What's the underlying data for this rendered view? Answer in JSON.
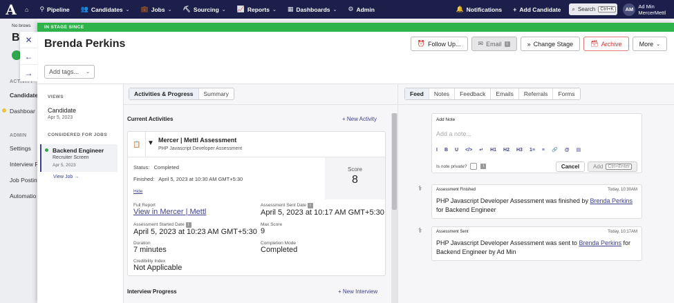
{
  "nav": {
    "items": [
      {
        "icon": "filter-icon",
        "glyph": "⚲",
        "label": "Pipeline",
        "caret": false
      },
      {
        "icon": "people-icon",
        "glyph": "👥",
        "label": "Candidates",
        "caret": true
      },
      {
        "icon": "briefcase-icon",
        "glyph": "💼",
        "label": "Jobs",
        "caret": true
      },
      {
        "icon": "sourcing-icon",
        "glyph": "⛏",
        "label": "Sourcing",
        "caret": true
      },
      {
        "icon": "chart-icon",
        "glyph": "📈",
        "label": "Reports",
        "caret": true
      },
      {
        "icon": "dashboard-icon",
        "glyph": "▦",
        "label": "Dashboards",
        "caret": true
      },
      {
        "icon": "gear-icon",
        "glyph": "⚙",
        "label": "Admin",
        "caret": false
      }
    ],
    "notifications": "Notifications",
    "add_candidate": "Add Candidate",
    "search": "Search",
    "search_kbd": "Ctrl+K",
    "avatar_initials": "AM",
    "user_name": "Ad Min",
    "user_org": "MercerMettl"
  },
  "background": {
    "title": "Ba",
    "browser_note": "No brows",
    "sections": [
      "ACTIVITY",
      "ADMIN"
    ],
    "items": [
      "Candidate",
      "Dashboar",
      "Settings",
      "Interview F",
      "Job Posting",
      "Automatio"
    ]
  },
  "drawer": {
    "stage_banner": "IN STAGE SINCE",
    "candidate_name": "Brenda Perkins",
    "tags_placeholder": "Add tags...",
    "actions": {
      "follow_up": "Follow Up...",
      "email": "Email",
      "change_stage": "Change Stage",
      "archive": "Archive",
      "more": "More"
    }
  },
  "left_panel": {
    "views_label": "VIEWS",
    "view_title": "Candidate",
    "view_date": "Apr 5, 2023",
    "considered_label": "CONSIDERED FOR JOBS",
    "job_title": "Backend Engineer",
    "job_stage": "Recruiter Screen",
    "job_date": "Apr 5, 2023",
    "view_job": "View Job →"
  },
  "middle": {
    "tabs": [
      "Activities & Progress",
      "Summary"
    ],
    "current_activities": "Current Activities",
    "new_activity": "+ New Activity",
    "assessment": {
      "title": "Mercer | Mettl Assessment",
      "subtitle": "PHP Javascript Developer Assessment",
      "status_label": "Status:",
      "status_value": "Completed",
      "finished_label": "Finished:",
      "finished_value": "April 5, 2023 at 10:30 AM GMT+5:30",
      "score_label": "Score",
      "score_value": "8",
      "hide": "Hide",
      "full_report_label": "Full Report",
      "full_report_link": "View in Mercer | Mettl",
      "sent_date_label": "Assessment Sent Date",
      "sent_date_value": "April 5, 2023 at 10:17 AM GMT+5:30",
      "started_date_label": "Assessment Started Date",
      "started_date_value": "April 5, 2023 at 10:23 AM GMT+5:30",
      "max_score_label": "Max Score",
      "max_score_value": "9",
      "duration_label": "Duration",
      "duration_value": "7 minutes",
      "completion_label": "Completion Mode",
      "completion_value": "Completed",
      "credibility_label": "Credibility Index",
      "credibility_value": "Not Applicable"
    },
    "interview_progress": "Interview Progress",
    "new_interview": "+ New Interview"
  },
  "right": {
    "tabs": [
      "Feed",
      "Notes",
      "Feedback",
      "Emails",
      "Referrals",
      "Forms"
    ],
    "note": {
      "header": "Add Note",
      "placeholder": "Add a note...",
      "private_label": "Is note private?",
      "cancel": "Cancel",
      "add": "Add",
      "add_kbd": "Ctrl+Enter",
      "toolbar": [
        "I",
        "B",
        "U",
        "</>",
        "↵",
        "H1",
        "H2",
        "H3",
        "1≡",
        "≡",
        "🔗",
        "@",
        "▤"
      ]
    },
    "feed": [
      {
        "type": "Assessment Finished",
        "time": "Today, 10:30AM",
        "subject": "PHP Javascript Developer Assessment",
        "verb": " was finished by ",
        "person": "Brenda Perkins",
        "tail": " for ",
        "job": "Backend Engineer",
        "tail2": ""
      },
      {
        "type": "Assessment Sent",
        "time": "Today, 10:17AM",
        "subject": "PHP Javascript Developer Assessment",
        "verb": " was sent to ",
        "person": "Brenda Perkins",
        "tail": " for ",
        "job": "Backend Engineer",
        "tail2": " by Ad Min"
      }
    ]
  }
}
